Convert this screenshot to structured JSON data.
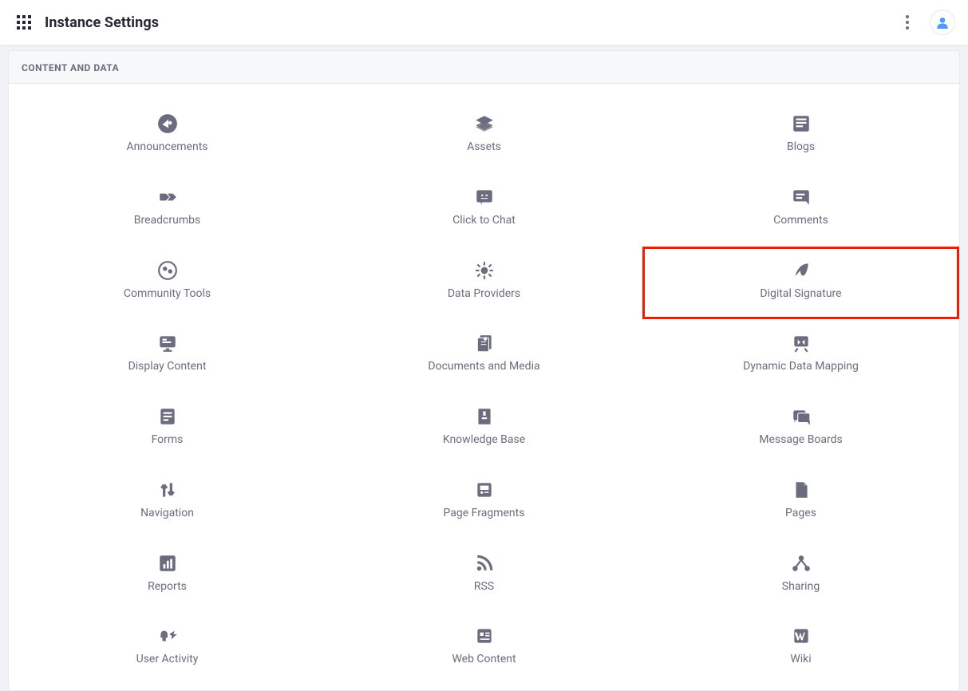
{
  "header": {
    "title": "Instance Settings"
  },
  "section": {
    "heading": "CONTENT AND DATA",
    "items": [
      {
        "icon": "announcements-icon",
        "label": "Announcements",
        "highlight": false
      },
      {
        "icon": "assets-icon",
        "label": "Assets",
        "highlight": false
      },
      {
        "icon": "blogs-icon",
        "label": "Blogs",
        "highlight": false
      },
      {
        "icon": "breadcrumbs-icon",
        "label": "Breadcrumbs",
        "highlight": false
      },
      {
        "icon": "click-to-chat-icon",
        "label": "Click to Chat",
        "highlight": false
      },
      {
        "icon": "comments-icon",
        "label": "Comments",
        "highlight": false
      },
      {
        "icon": "community-tools-icon",
        "label": "Community Tools",
        "highlight": false
      },
      {
        "icon": "data-providers-icon",
        "label": "Data Providers",
        "highlight": false
      },
      {
        "icon": "digital-signature-icon",
        "label": "Digital Signature",
        "highlight": true
      },
      {
        "icon": "display-content-icon",
        "label": "Display Content",
        "highlight": false
      },
      {
        "icon": "documents-media-icon",
        "label": "Documents and Media",
        "highlight": false
      },
      {
        "icon": "dynamic-data-mapping-icon",
        "label": "Dynamic Data Mapping",
        "highlight": false
      },
      {
        "icon": "forms-icon",
        "label": "Forms",
        "highlight": false
      },
      {
        "icon": "knowledge-base-icon",
        "label": "Knowledge Base",
        "highlight": false
      },
      {
        "icon": "message-boards-icon",
        "label": "Message Boards",
        "highlight": false
      },
      {
        "icon": "navigation-icon",
        "label": "Navigation",
        "highlight": false
      },
      {
        "icon": "page-fragments-icon",
        "label": "Page Fragments",
        "highlight": false
      },
      {
        "icon": "pages-icon",
        "label": "Pages",
        "highlight": false
      },
      {
        "icon": "reports-icon",
        "label": "Reports",
        "highlight": false
      },
      {
        "icon": "rss-icon",
        "label": "RSS",
        "highlight": false
      },
      {
        "icon": "sharing-icon",
        "label": "Sharing",
        "highlight": false
      },
      {
        "icon": "user-activity-icon",
        "label": "User Activity",
        "highlight": false
      },
      {
        "icon": "web-content-icon",
        "label": "Web Content",
        "highlight": false
      },
      {
        "icon": "wiki-icon",
        "label": "Wiki",
        "highlight": false
      }
    ]
  }
}
